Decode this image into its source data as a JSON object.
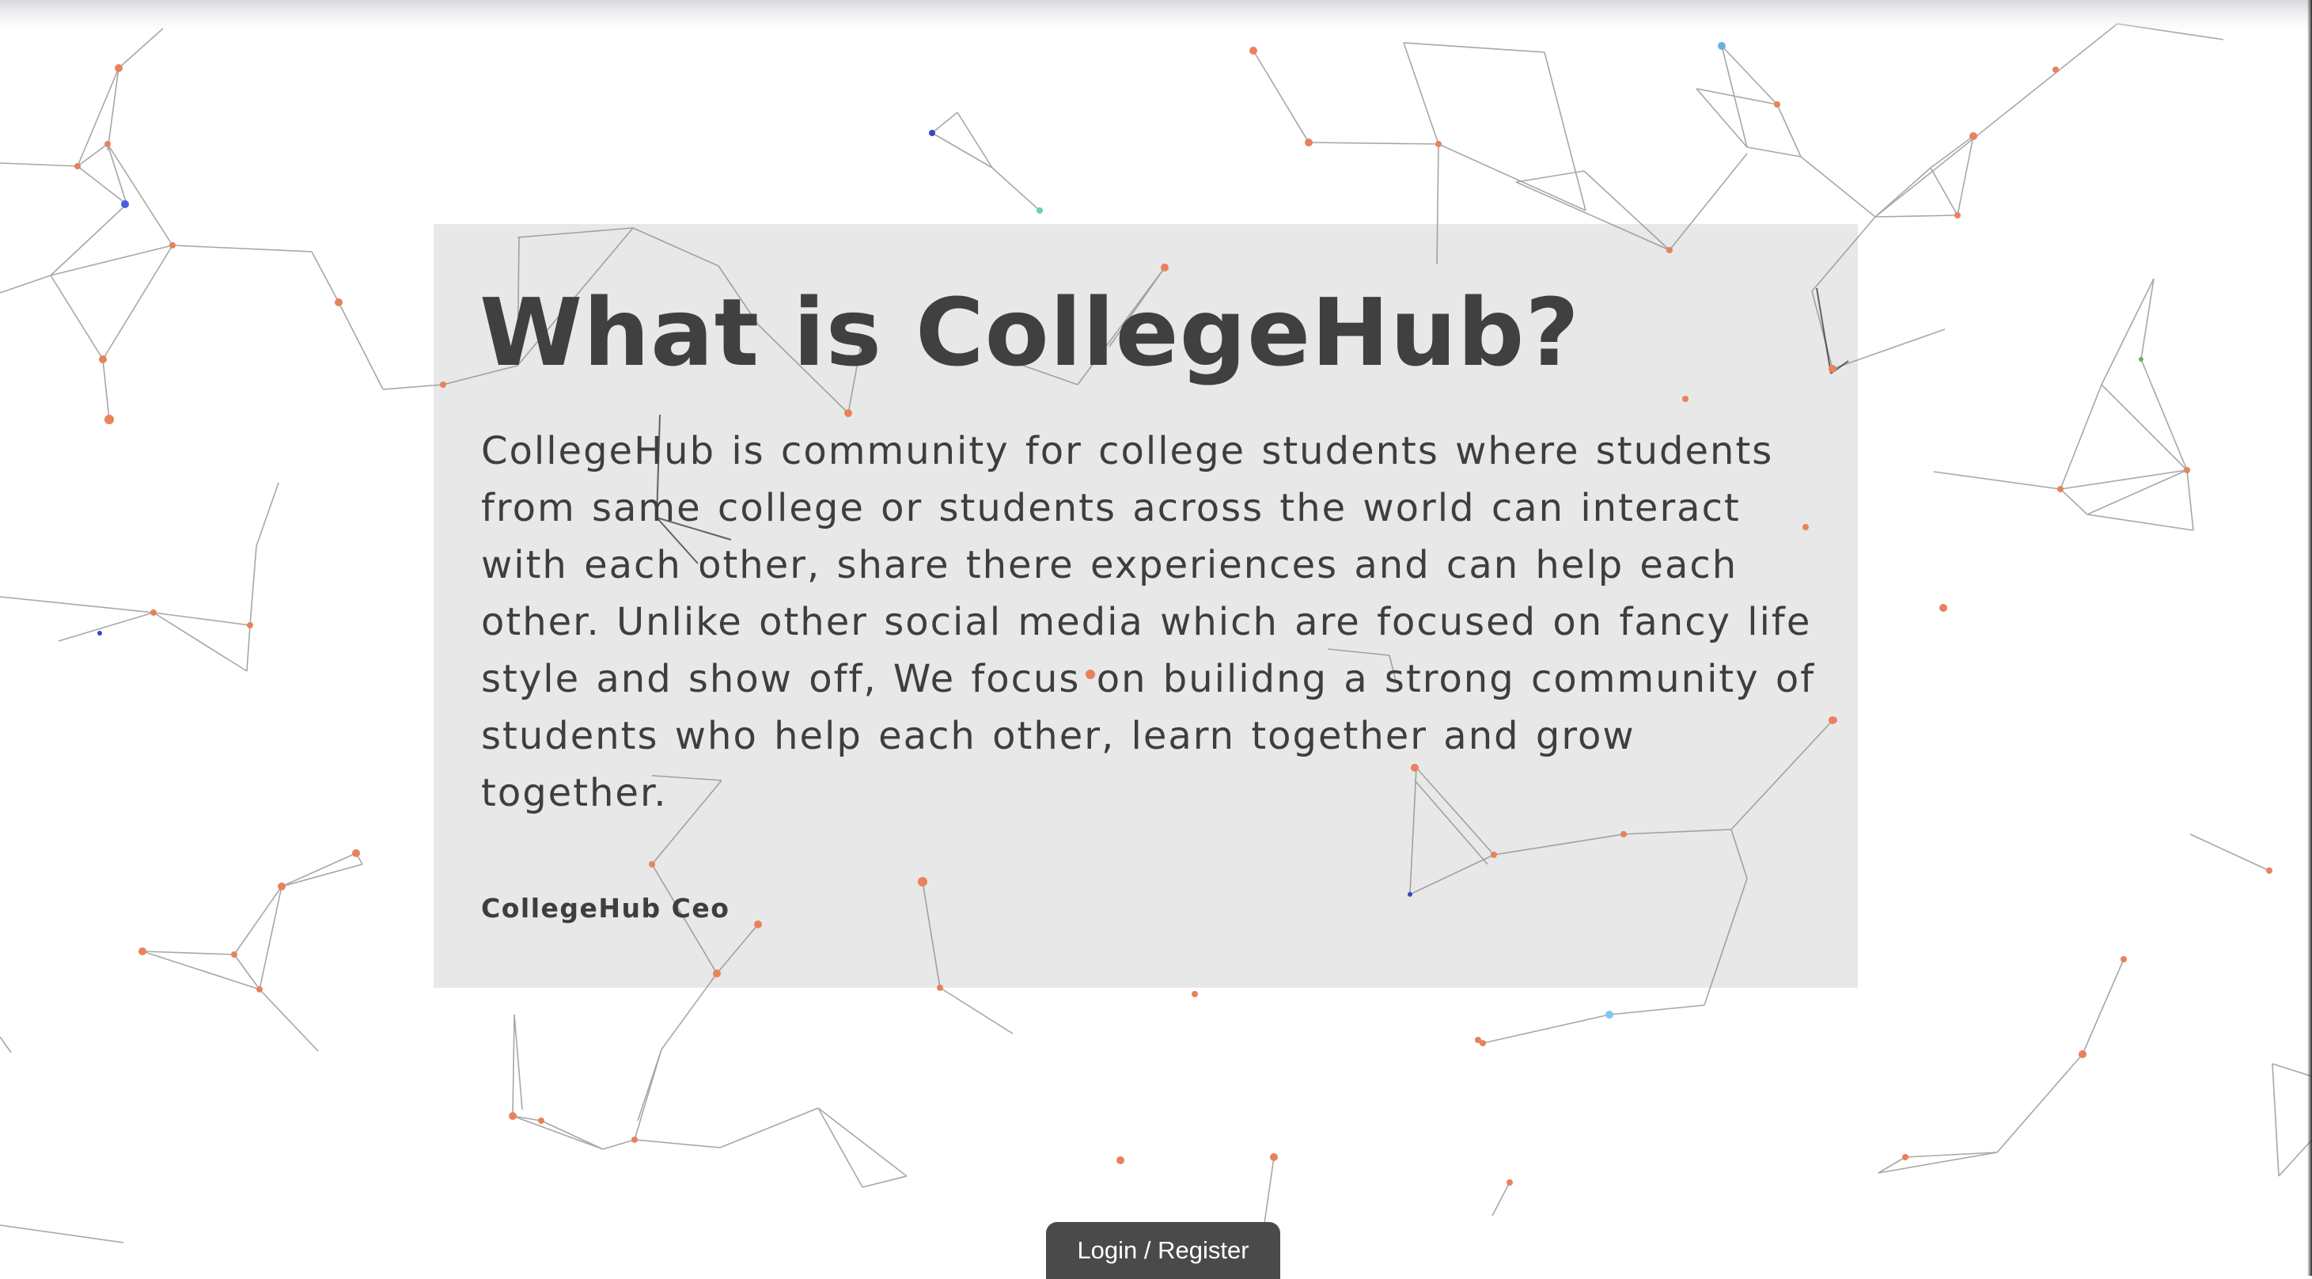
{
  "about": {
    "heading": "What is CollegeHub?",
    "description": "CollegeHub is community for college students where students from same college or students across the world can interact with each other, share there experiences and can help each other. Unlike other social media which are focused on fancy life style and show off, We focus on builidng a strong community of students who help each other, learn together and grow together.",
    "signature": "CollegeHub Ceo"
  },
  "actions": {
    "login_register_label": "Login / Register"
  },
  "colors": {
    "card_background": "#e8e8e8",
    "text": "#404040",
    "button_background": "#4a4a4a",
    "node_accent": "#e8825a"
  }
}
